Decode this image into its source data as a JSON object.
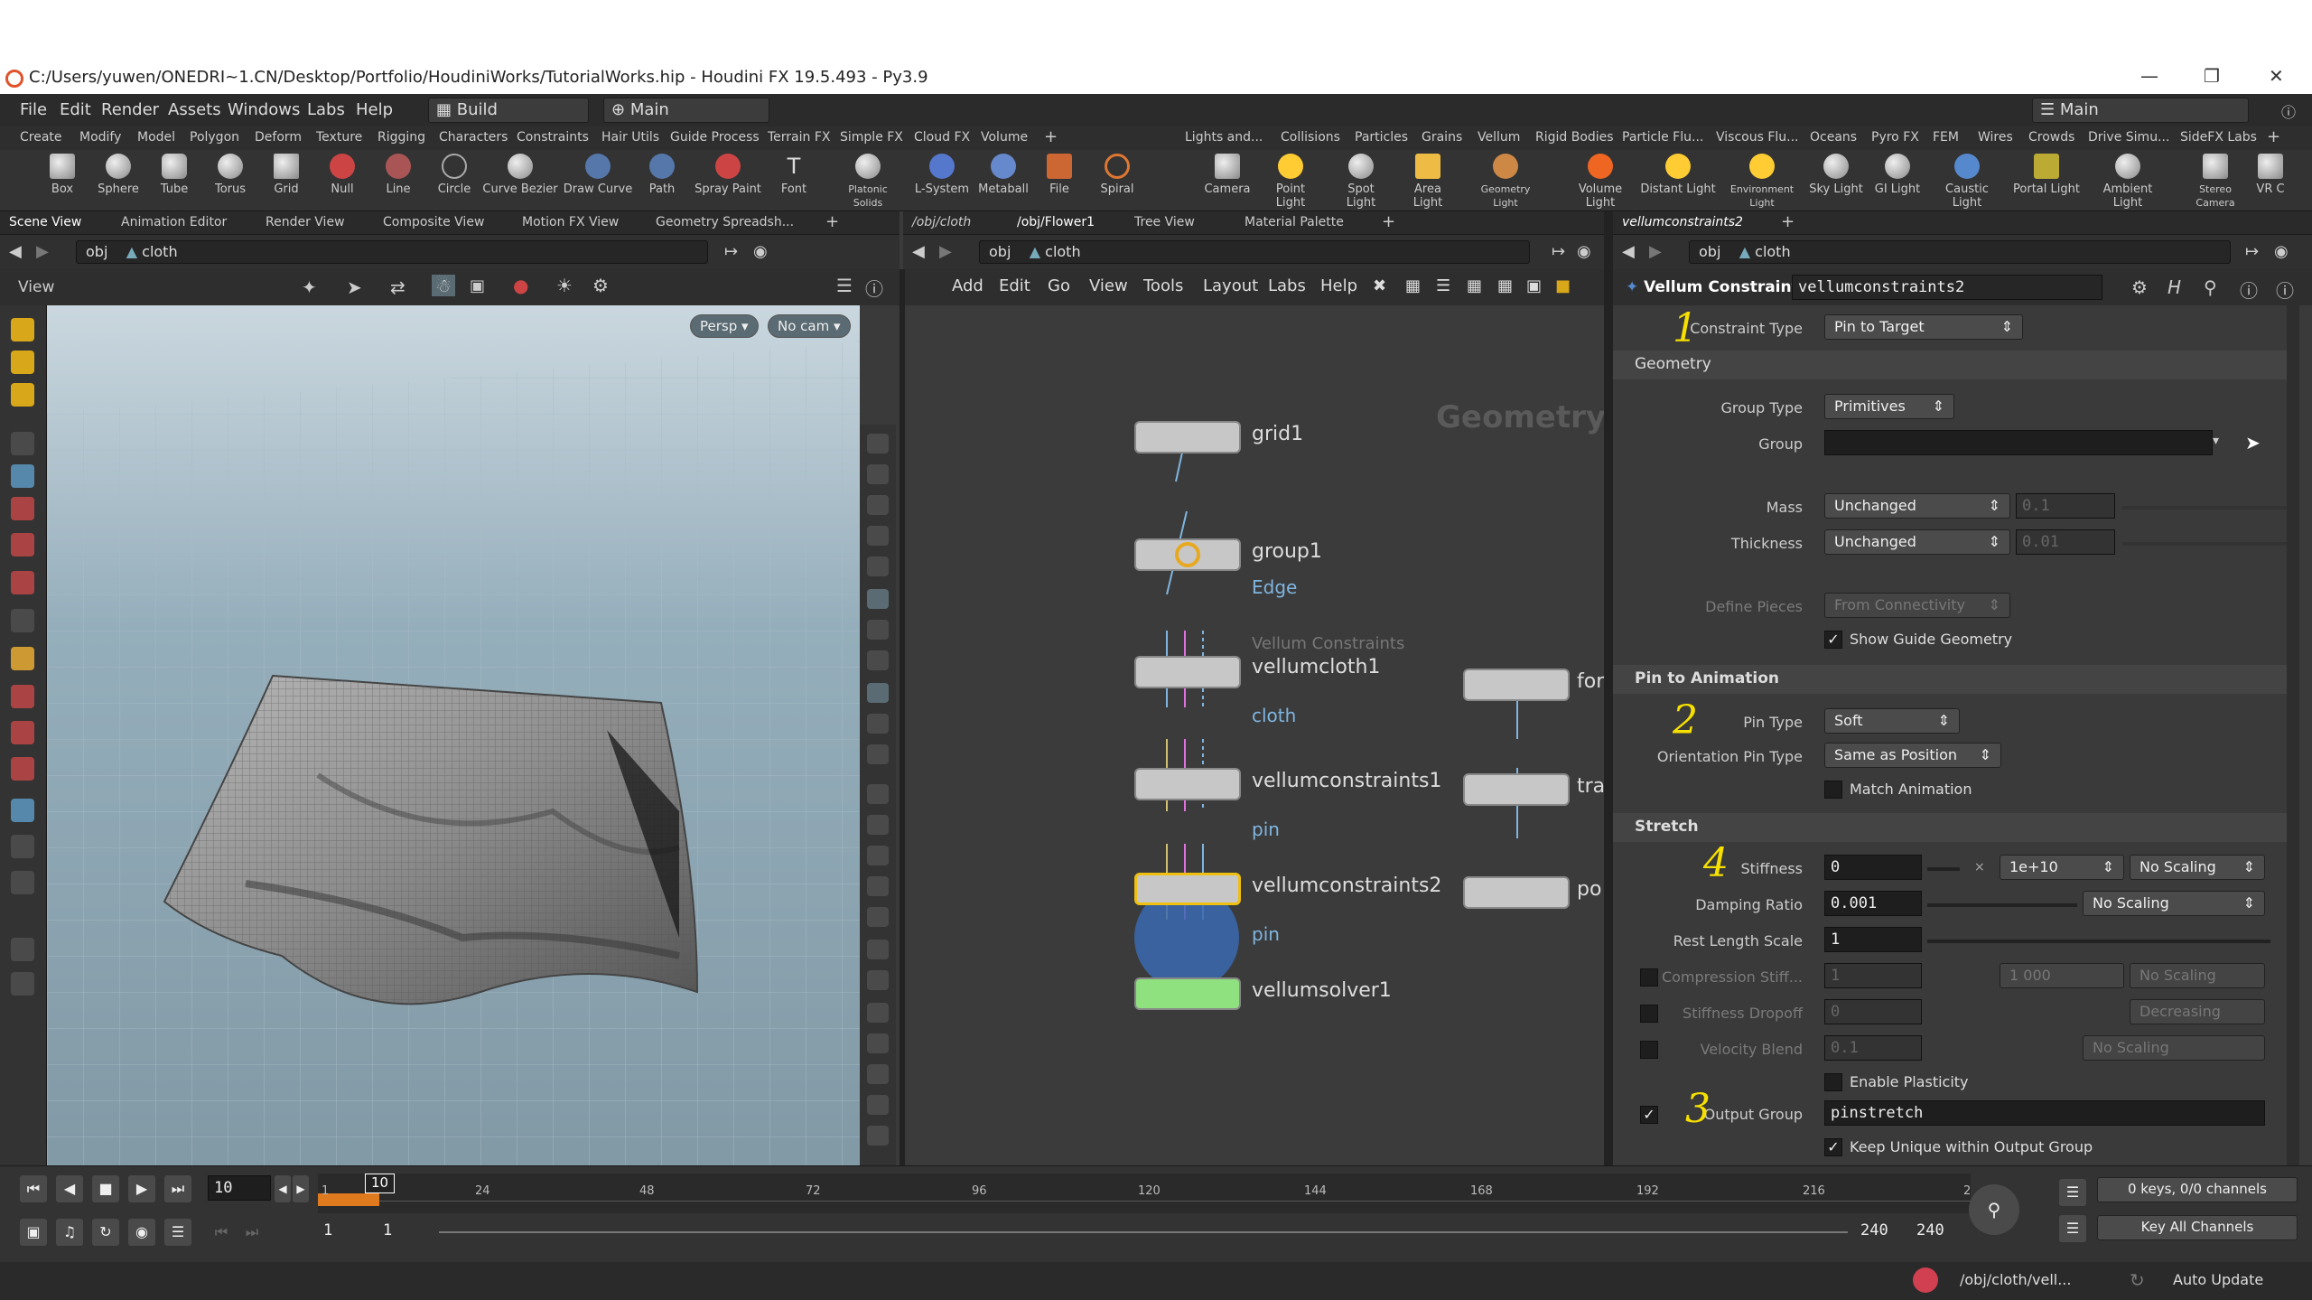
{
  "window": {
    "title": "C:/Users/yuwen/ONEDRI~1.CN/Desktop/Portfolio/HoudiniWorks/TutorialWorks.hip - Houdini FX 19.5.493 - Py3.9",
    "minimize": "—",
    "maximize": "❐",
    "close": "✕"
  },
  "menubar": {
    "items": [
      "File",
      "Edit",
      "Render",
      "Assets",
      "Windows",
      "Labs",
      "Help"
    ],
    "build_label": "Build",
    "desktop_label": "Main",
    "right_desktop": "Main"
  },
  "shelf_tabs_left": [
    "Create",
    "Modify",
    "Model",
    "Polygon",
    "Deform",
    "Texture",
    "Rigging",
    "Characters",
    "Constraints",
    "Hair Utils",
    "Guide Process",
    "Terrain FX",
    "Simple FX",
    "Cloud FX",
    "Volume"
  ],
  "shelf_tabs_right": [
    "Lights and...",
    "Collisions",
    "Particles",
    "Grains",
    "Vellum",
    "Rigid Bodies",
    "Particle Flu...",
    "Viscous Flu...",
    "Oceans",
    "Pyro FX",
    "FEM",
    "Wires",
    "Crowds",
    "Drive Simu...",
    "SideFX Labs"
  ],
  "tools_left": [
    "Box",
    "Sphere",
    "Tube",
    "Torus",
    "Grid",
    "Null",
    "Line",
    "Circle",
    "Curve Bezier",
    "Draw Curve",
    "Path",
    "Spray Paint",
    "Font",
    "Platonic Solids",
    "L-System",
    "Metaball",
    "File",
    "Spiral"
  ],
  "tools_right": [
    "Camera",
    "Point Light",
    "Spot Light",
    "Area Light",
    "Geometry Light",
    "Volume Light",
    "Distant Light",
    "Environment Light",
    "Sky Light",
    "GI Light",
    "Caustic Light",
    "Portal Light",
    "Ambient Light",
    "Stereo Camera",
    "VR C"
  ],
  "left_pane": {
    "tabs": [
      "Scene View",
      "Animation Editor",
      "Render View",
      "Composite View",
      "Motion FX View",
      "Geometry Spreadsh..."
    ],
    "path_obj": "obj",
    "path_node": "cloth",
    "view_label": "View",
    "persp": "Persp ▾",
    "cam": "No cam ▾"
  },
  "mid_pane": {
    "tabs": [
      "/obj/cloth",
      "/obj/Flower1",
      "Tree View",
      "Material Palette"
    ],
    "path_obj": "obj",
    "path_node": "cloth",
    "menu": [
      "Add",
      "Edit",
      "Go",
      "View",
      "Tools",
      "Layout",
      "Labs",
      "Help"
    ],
    "watermark": "Geometry",
    "nodes": [
      {
        "name": "grid1",
        "sub": ""
      },
      {
        "name": "group1",
        "sub": "Edge"
      },
      {
        "name": "vellumcloth1",
        "sub": "cloth",
        "type": "Vellum Constraints"
      },
      {
        "name": "vellumconstraints1",
        "sub": "pin"
      },
      {
        "name": "vellumconstraints2",
        "sub": "pin"
      },
      {
        "name": "vellumsolver1",
        "sub": ""
      },
      {
        "name": "for",
        "sub": ""
      },
      {
        "name": "tra",
        "sub": ""
      },
      {
        "name": "po",
        "sub": ""
      }
    ]
  },
  "right_pane": {
    "tab": "vellumconstraints2",
    "path_obj": "obj",
    "path_node": "cloth",
    "node_type": "Vellum Constraints",
    "node_name": "vellumconstraints2",
    "constraint_type_label": "Constraint Type",
    "constraint_type": "Pin to Target",
    "sec_geometry": "Geometry",
    "group_type_label": "Group Type",
    "group_type": "Primitives",
    "group_label": "Group",
    "group_value": "",
    "mass_label": "Mass",
    "mass_mode": "Unchanged",
    "mass_value": "0.1",
    "thickness_label": "Thickness",
    "thickness_mode": "Unchanged",
    "thickness_value": "0.01",
    "define_pieces_label": "Define Pieces",
    "define_pieces": "From Connectivity",
    "show_guide": "Show Guide Geometry",
    "sec_pin": "Pin to Animation",
    "pin_type_label": "Pin Type",
    "pin_type": "Soft",
    "orient_pin_label": "Orientation Pin Type",
    "orient_pin": "Same as Position",
    "match_anim": "Match Animation",
    "sec_stretch": "Stretch",
    "stiffness_label": "Stiffness",
    "stiffness": "0",
    "stiffness_mult": "1e+10",
    "no_scaling": "No Scaling",
    "damping_label": "Damping Ratio",
    "damping": "0.001",
    "rest_label": "Rest Length Scale",
    "rest": "1",
    "compress_label": "Compression Stiff...",
    "compress": "1",
    "compress_mult": "1 000",
    "stiff_drop_label": "Stiffness Dropoff",
    "stiff_drop": "0",
    "decreasing": "Decreasing",
    "vel_blend_label": "Velocity Blend",
    "vel_blend": "0.1",
    "enable_plast": "Enable Plasticity",
    "output_group_label": "Output Group",
    "output_group": "pinstretch",
    "keep_unique": "Keep Unique within Output Group",
    "annotations": [
      "1",
      "2",
      "4",
      "3"
    ]
  },
  "timeline": {
    "frame": "10",
    "frame_marker": "10",
    "ticks": [
      "1",
      "24",
      "48",
      "72",
      "96",
      "120",
      "144",
      "168",
      "192",
      "216",
      "2"
    ],
    "start": "1",
    "start2": "1",
    "end": "240",
    "end2": "240",
    "keys": "0 keys, 0/0 channels",
    "key_all": "Key All Channels",
    "path": "/obj/cloth/vell...",
    "auto_update": "Auto Update"
  },
  "colors": {
    "accent": "#f0c010",
    "timeline_range": "#e07a1f",
    "annotation": "#f7e000"
  }
}
